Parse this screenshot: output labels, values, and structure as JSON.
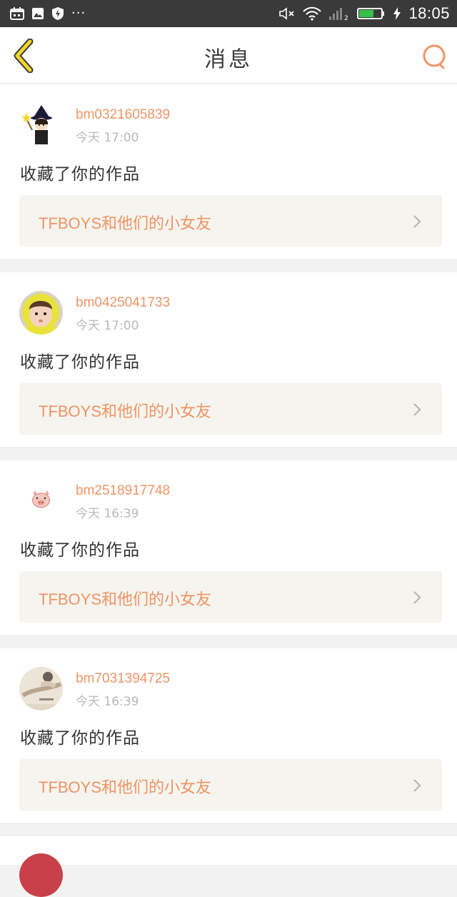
{
  "status_bar": {
    "time": "18:05",
    "left_icons": [
      "calendar-icon",
      "image-icon",
      "shield-bolt-icon",
      "more-dots-icon"
    ],
    "right_icons": [
      "mute-icon",
      "wifi-icon",
      "signal-icon",
      "battery-icon",
      "charging-icon"
    ],
    "more": "···",
    "sim_slot": "2"
  },
  "header": {
    "title": "消息",
    "back_icon": "chevron-left-icon",
    "search_icon": "search-icon"
  },
  "colors": {
    "accent": "#ef9464",
    "back_arrow": "#f3d62a",
    "card_bg": "#ffffff",
    "work_bg": "#f5f4ef",
    "page_bg": "#f2f2f2"
  },
  "messages": [
    {
      "username": "bm0321605839",
      "time": "今天 17:00",
      "action": "收藏了你的作品",
      "work_title": "TFBOYS和他们的小女友",
      "avatar": "witch-avatar"
    },
    {
      "username": "bm0425041733",
      "time": "今天 17:00",
      "action": "收藏了你的作品",
      "work_title": "TFBOYS和他们的小女友",
      "avatar": "child-yellow-hood-avatar"
    },
    {
      "username": "bm2518917748",
      "time": "今天 16:39",
      "action": "收藏了你的作品",
      "work_title": "TFBOYS和他们的小女友",
      "avatar": "pig-avatar"
    },
    {
      "username": "bm7031394725",
      "time": "今天 16:39",
      "action": "收藏了你的作品",
      "work_title": "TFBOYS和他们的小女友",
      "avatar": "photo-avatar"
    }
  ]
}
